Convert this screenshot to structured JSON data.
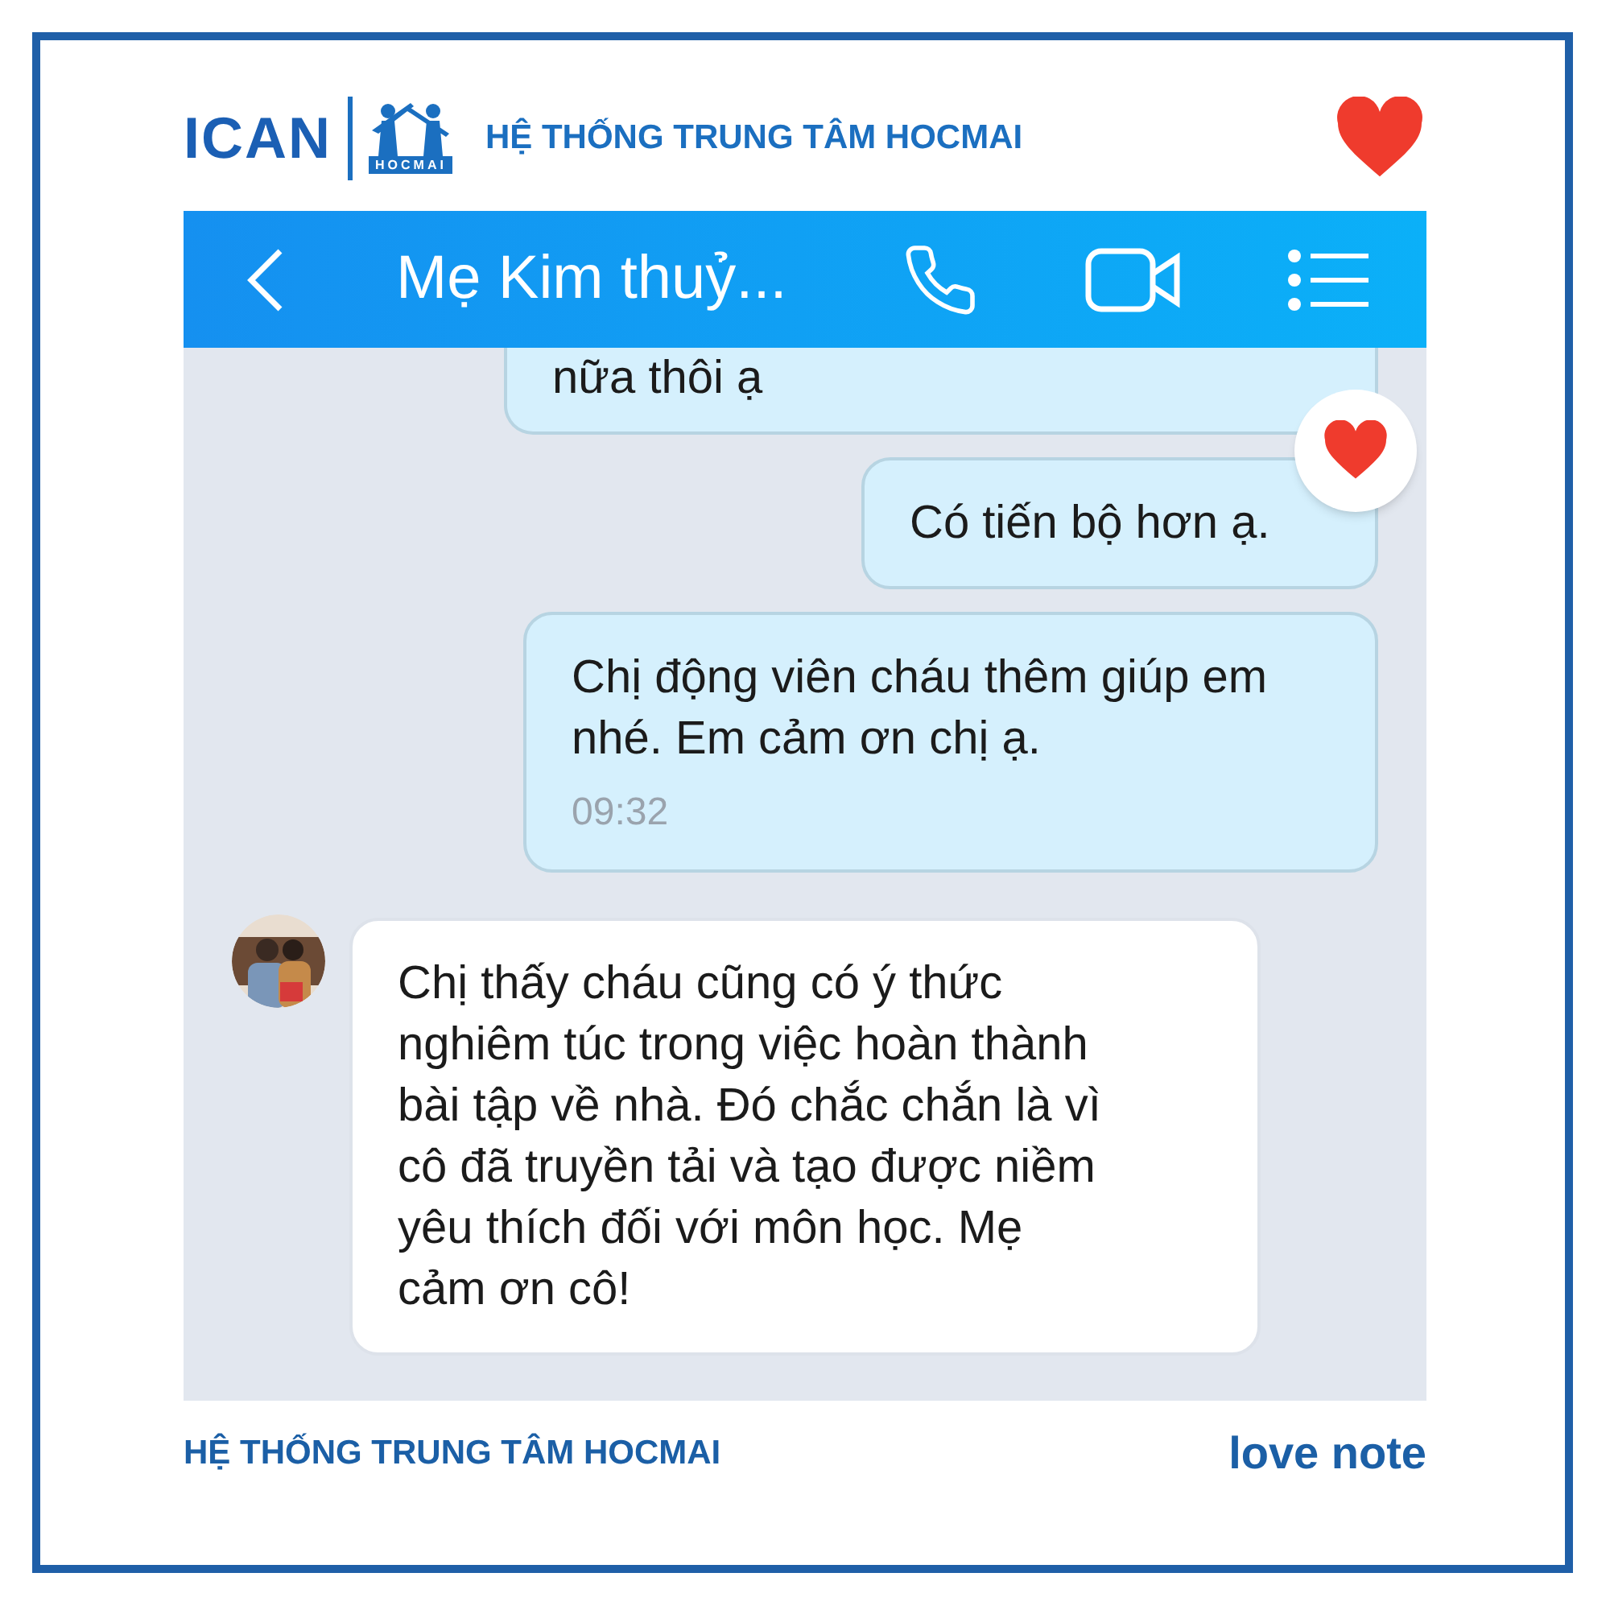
{
  "brand": {
    "logo_left": "ICAN",
    "logo_right": "HOCMAI",
    "title": "HỆ THỐNG TRUNG TÂM HOCMAI"
  },
  "chat": {
    "title": "Mẹ Kim thuỷ...",
    "messages": [
      {
        "kind": "outgoing",
        "clipped": true,
        "text": "nữa thôi ạ"
      },
      {
        "kind": "outgoing",
        "text": "Có tiến bộ hơn ạ.",
        "reacted": true
      },
      {
        "kind": "outgoing",
        "text": "Chị động viên cháu thêm giúp em nhé. Em cảm ơn chị ạ.",
        "time": "09:32"
      },
      {
        "kind": "incoming",
        "text": "Chị thấy cháu cũng có ý thức nghiêm túc trong việc hoàn thành bài tập về nhà. Đó chắc chắn là vì cô đã truyền tải và tạo được niềm yêu thích đối với môn học. Mẹ cảm ơn cô!"
      }
    ]
  },
  "footer": {
    "left": "HỆ THỐNG TRUNG TÂM HOCMAI",
    "right": "love note"
  }
}
